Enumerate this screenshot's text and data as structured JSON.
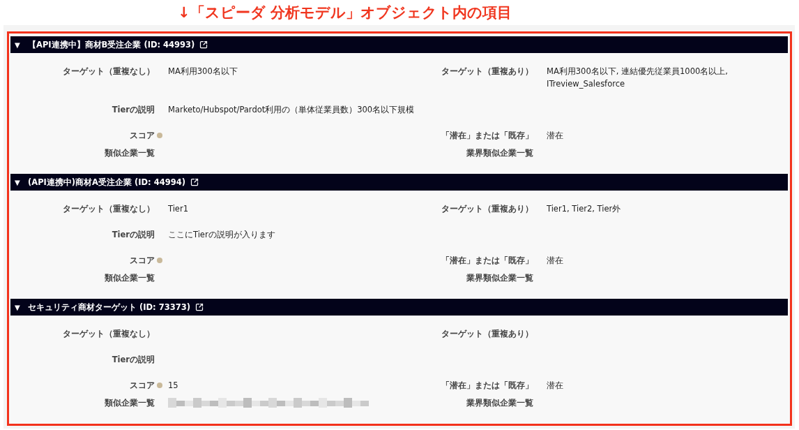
{
  "annotation": {
    "text": "↓「スピーダ 分析モデル」オブジェクト内の項目"
  },
  "sections": [
    {
      "toggle": "▼",
      "expanded": true,
      "title": "【API連携中】商材B受注企業 (ID: 44993)",
      "rows": [
        {
          "left": {
            "label": "ターゲット（重複なし）",
            "value": "MA利用300名以下"
          },
          "right": {
            "label": "ターゲット（重複あり）",
            "value": "MA利用300名以下, 連結優先従業員1000名以上, ITreview_Salesforce"
          }
        },
        {
          "left": {
            "label": "Tierの説明",
            "value": "Marketo/Hubspot/Pardot利用の（単体従業員数）300名以下規模"
          }
        },
        {
          "left": {
            "label": "スコア",
            "help": true
          },
          "right": {
            "label": "「潜在」または「既存」",
            "value": "潜在"
          }
        },
        {
          "left": {
            "label": "類似企業一覧"
          },
          "right": {
            "label": "業界類似企業一覧"
          }
        }
      ]
    },
    {
      "toggle": "▼",
      "expanded": true,
      "title": "(API連携中)商材A受注企業 (ID: 44994)",
      "rows": [
        {
          "left": {
            "label": "ターゲット（重複なし）",
            "value": "Tier1"
          },
          "right": {
            "label": "ターゲット（重複あり）",
            "value": "Tier1, Tier2, Tier外"
          }
        },
        {
          "left": {
            "label": "Tierの説明",
            "value": "ここにTierの説明が入ります"
          }
        },
        {
          "left": {
            "label": "スコア",
            "help": true
          },
          "right": {
            "label": "「潜在」または「既存」",
            "value": "潜在"
          }
        },
        {
          "left": {
            "label": "類似企業一覧"
          },
          "right": {
            "label": "業界類似企業一覧"
          }
        }
      ]
    },
    {
      "toggle": "▼",
      "expanded": true,
      "title": "セキュリティ商材ターゲット (ID: 73373)",
      "rows": [
        {
          "left": {
            "label": "ターゲット（重複なし）"
          },
          "right": {
            "label": "ターゲット（重複あり）"
          }
        },
        {
          "left": {
            "label": "Tierの説明"
          }
        },
        {
          "left": {
            "label": "スコア",
            "help": true,
            "value": "15"
          },
          "right": {
            "label": "「潜在」または「既存」",
            "value": "潜在"
          }
        },
        {
          "left": {
            "label": "類似企業一覧",
            "blurred": true
          },
          "right": {
            "label": "業界類似企業一覧"
          }
        }
      ]
    }
  ]
}
